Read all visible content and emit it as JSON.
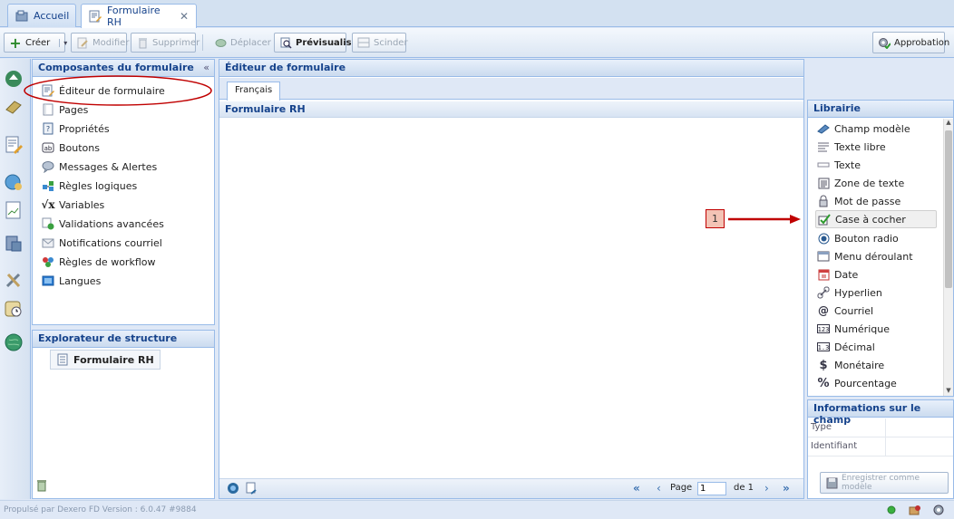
{
  "tabs": [
    {
      "label": "Accueil",
      "icon": "home-icon"
    },
    {
      "label": "Formulaire RH",
      "icon": "form-icon",
      "close": "✕"
    }
  ],
  "toolbar": {
    "create": "Créer",
    "modify": "Modifier",
    "delete": "Supprimer",
    "move": "Déplacer",
    "preview": "Prévisualiser",
    "split": "Scinder",
    "approval": "Approbation"
  },
  "components_panel": {
    "title": "Composantes du formulaire",
    "collapse": "«",
    "items": [
      {
        "label": "Éditeur de formulaire",
        "icon": "form-editor-icon"
      },
      {
        "label": "Pages",
        "icon": "pages-icon"
      },
      {
        "label": "Propriétés",
        "icon": "properties-icon"
      },
      {
        "label": "Boutons",
        "icon": "buttons-icon"
      },
      {
        "label": "Messages & Alertes",
        "icon": "speech-bubble-icon"
      },
      {
        "label": "Règles logiques",
        "icon": "logic-rules-icon"
      },
      {
        "label": "Variables",
        "icon": "sqrt-x-icon"
      },
      {
        "label": "Validations avancées",
        "icon": "validation-icon"
      },
      {
        "label": "Notifications courriel",
        "icon": "envelope-icon"
      },
      {
        "label": "Règles de workflow",
        "icon": "workflow-icon"
      },
      {
        "label": "Langues",
        "icon": "languages-icon"
      }
    ]
  },
  "structure_panel": {
    "title": "Explorateur de structure",
    "root": "Formulaire RH"
  },
  "editor": {
    "title": "Éditeur de formulaire",
    "lang_tab": "Français",
    "form_title": "Formulaire RH",
    "pager": {
      "page_label": "Page",
      "page_value": "1",
      "of_label": "de 1"
    }
  },
  "library": {
    "title": "Librairie",
    "items": [
      {
        "label": "Champ modèle",
        "icon": "template-field-icon"
      },
      {
        "label": "Texte libre",
        "icon": "free-text-icon"
      },
      {
        "label": "Texte",
        "icon": "text-input-icon"
      },
      {
        "label": "Zone de texte",
        "icon": "textarea-icon"
      },
      {
        "label": "Mot de passe",
        "icon": "lock-icon"
      },
      {
        "label": "Case à cocher",
        "icon": "checkbox-icon"
      },
      {
        "label": "Bouton radio",
        "icon": "radio-icon"
      },
      {
        "label": "Menu déroulant",
        "icon": "dropdown-icon"
      },
      {
        "label": "Date",
        "icon": "calendar-icon"
      },
      {
        "label": "Hyperlien",
        "icon": "link-icon"
      },
      {
        "label": "Courriel",
        "icon": "at-icon"
      },
      {
        "label": "Numérique",
        "icon": "number-icon"
      },
      {
        "label": "Décimal",
        "icon": "decimal-icon"
      },
      {
        "label": "Monétaire",
        "icon": "currency-icon"
      },
      {
        "label": "Pourcentage",
        "icon": "percent-icon"
      }
    ],
    "selected_index": 5
  },
  "field_info": {
    "title": "Informations sur le champ",
    "rows": [
      {
        "label": "Type",
        "value": ""
      },
      {
        "label": "Identifiant",
        "value": ""
      }
    ],
    "save_template": "Enregistrer comme modèle"
  },
  "annotation": {
    "number": "1"
  },
  "footer": {
    "powered": "Propulsé par Dexero FD Version : 6.0.47 #9884"
  },
  "colors": {
    "header_text": "#15428b",
    "border": "#99bbe8",
    "annotation_red": "#c00000",
    "annotation_box": "#f3c3b5"
  }
}
